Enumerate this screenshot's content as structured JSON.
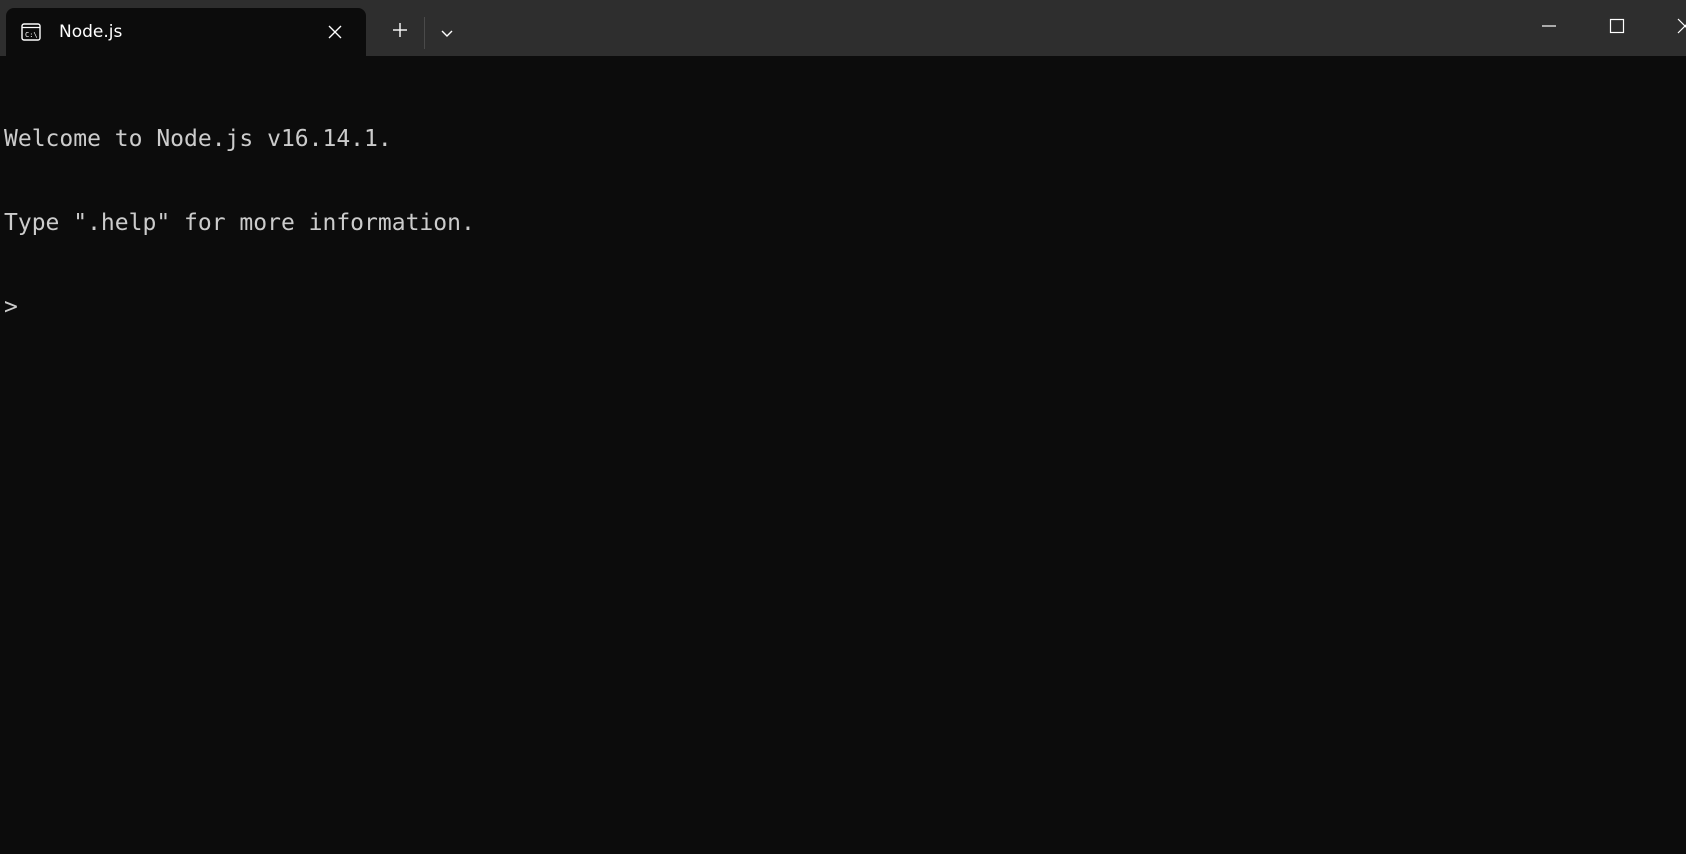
{
  "window": {
    "tab_title": "Node.js",
    "tab_icon": "command-prompt-icon",
    "new_tab_icon": "plus-icon",
    "dropdown_icon": "chevron-down-icon",
    "minimize_icon": "minimize-icon",
    "maximize_icon": "maximize-icon",
    "close_icon": "close-icon"
  },
  "colors": {
    "titlebar_bg": "#2e2e2e",
    "terminal_bg": "#0c0c0c",
    "terminal_fg": "#cccccc"
  },
  "terminal": {
    "lines": [
      "Welcome to Node.js v16.14.1.",
      "Type \".help\" for more information.",
      ">"
    ]
  }
}
